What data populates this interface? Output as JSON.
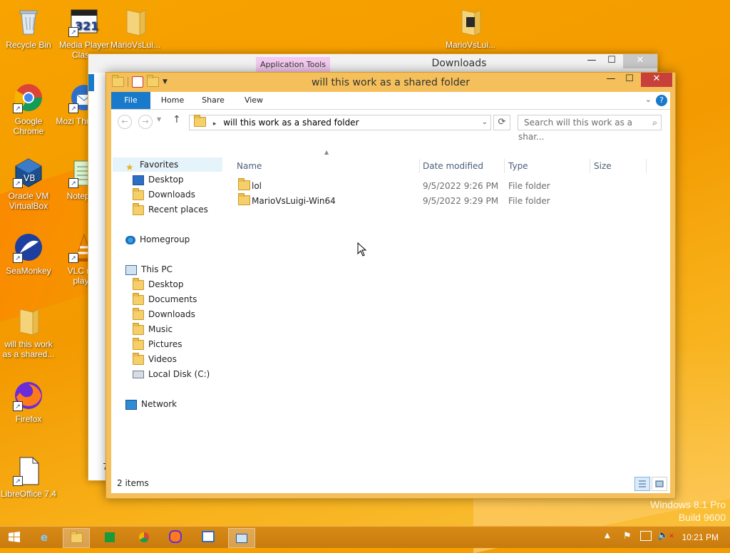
{
  "desktop": {
    "icons": [
      {
        "label": "Recycle Bin",
        "icon": "recycle-bin-icon"
      },
      {
        "label": "Media Player Clas...",
        "icon": "media-player-classic-icon"
      },
      {
        "label": "MarioVsLui...",
        "icon": "folder-icon"
      },
      {
        "label": "MarioVsLui...",
        "icon": "folder-icon"
      },
      {
        "label": "Google Chrome",
        "icon": "chrome-icon"
      },
      {
        "label": "Mozi Thunde...",
        "icon": "thunderbird-icon"
      },
      {
        "label": "Oracle VM VirtualBox",
        "icon": "virtualbox-icon"
      },
      {
        "label": "Notepa...",
        "icon": "notepad-icon"
      },
      {
        "label": "SeaMonkey",
        "icon": "seamonkey-icon"
      },
      {
        "label": "VLC m... play...",
        "icon": "vlc-icon"
      },
      {
        "label": "will this work as a shared...",
        "icon": "folder-icon"
      },
      {
        "label": "Firefox",
        "icon": "firefox-icon"
      },
      {
        "label": "LibreOffice 7.4",
        "icon": "libreoffice-icon"
      }
    ]
  },
  "back_window": {
    "title": "Downloads",
    "context_tab": "Application Tools",
    "left_fragment": "7"
  },
  "window": {
    "title": "will this work as a shared folder",
    "ribbon_tabs": [
      "File",
      "Home",
      "Share",
      "View"
    ],
    "address": "will this work as a shared folder",
    "search_placeholder": "Search will this work as a shar...",
    "nav": {
      "favorites": "Favorites",
      "favorites_items": [
        "Desktop",
        "Downloads",
        "Recent places"
      ],
      "homegroup": "Homegroup",
      "this_pc": "This PC",
      "this_pc_items": [
        "Desktop",
        "Documents",
        "Downloads",
        "Music",
        "Pictures",
        "Videos",
        "Local Disk (C:)"
      ],
      "network": "Network"
    },
    "columns": [
      "Name",
      "Date modified",
      "Type",
      "Size"
    ],
    "rows": [
      {
        "name": "lol",
        "date": "9/5/2022 9:26 PM",
        "type": "File folder",
        "size": ""
      },
      {
        "name": "MarioVsLuigi-Win64",
        "date": "9/5/2022 9:29 PM",
        "type": "File folder",
        "size": ""
      }
    ],
    "status": "2 items"
  },
  "taskbar": {
    "clock": "10:21 PM",
    "watermark_line1": "Windows 8.1 Pro",
    "watermark_line2": "Build 9600"
  },
  "colors": {
    "accent": "#1979ca",
    "wallpaper": "#f7a300",
    "window_frame": "#f5c05b"
  }
}
